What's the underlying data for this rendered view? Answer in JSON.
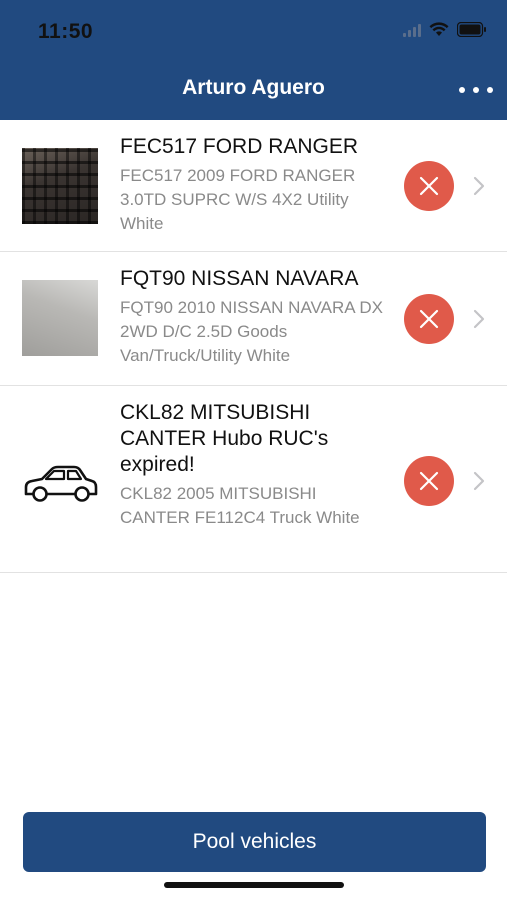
{
  "status_bar": {
    "time": "11:50"
  },
  "header": {
    "title": "Arturo Aguero",
    "more_icon": "more-horizontal-icon"
  },
  "vehicles": [
    {
      "title": "FEC517 FORD RANGER",
      "subtitle": "FEC517 2009 FORD RANGER 3.0TD SUPRC W/S 4X2 Utility White",
      "thumbnail": "photo-keyboard"
    },
    {
      "title": "FQT90 NISSAN NAVARA",
      "subtitle": "FQT90 2010 NISSAN NAVARA DX 2WD D/C 2.5D Goods Van/Truck/Utility White",
      "thumbnail": "photo-gray"
    },
    {
      "title": "CKL82 MITSUBISHI CANTER Hubo RUC's expired!",
      "subtitle": "CKL82 2005 MITSUBISHI CANTER FE112C4 Truck White",
      "thumbnail": "car-icon"
    }
  ],
  "footer": {
    "button_label": "Pool vehicles"
  },
  "colors": {
    "primary": "#214a80",
    "delete": "#e05a4a",
    "subtitle": "#8a8a8a"
  }
}
